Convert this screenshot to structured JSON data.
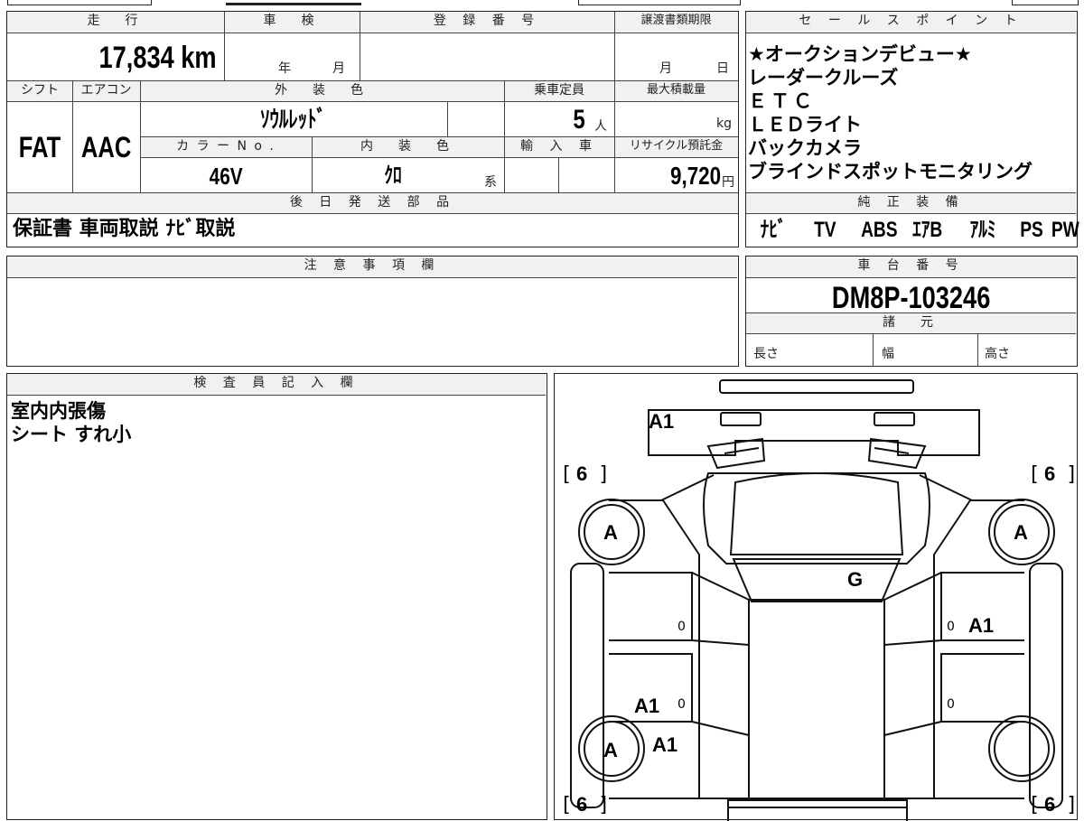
{
  "vehicle": {
    "mileage_label": "走　行",
    "mileage_value": "17,834 km",
    "inspection_label": "車　検",
    "inspection_year_unit": "年",
    "inspection_month_unit": "月",
    "registration_label": "登 録 番 号",
    "transfer_deadline_label": "譲渡書類期限",
    "transfer_month_unit": "月",
    "transfer_day_unit": "日",
    "shift_label": "シフト",
    "ac_label": "エアコン",
    "exterior_color_label": "外　装　色",
    "capacity_label": "乗車定員",
    "max_load_label": "最大積載量",
    "shift_value": "FAT",
    "ac_value": "AAC",
    "exterior_color_value": "ｿｳﾙﾚｯﾄﾞ",
    "capacity_value": "5",
    "capacity_unit": "人",
    "max_load_unit": "kg",
    "color_no_label": "カ ラ ー N o .",
    "interior_color_label": "内　装　色",
    "import_label": "輸 入 車",
    "recycle_label": "リサイクル預託金",
    "color_no_value": "46V",
    "interior_color_value": "ｸﾛ",
    "interior_color_suffix": "系",
    "recycle_value": "9,720",
    "recycle_unit": "円",
    "later_parts_label": "後 日 発 送 部 品",
    "later_parts_value": "保証書 車両取説 ﾅﾋﾞ取説"
  },
  "sales_points": {
    "label": "セ ー ル ス ポ イ ン ト",
    "items": [
      "★オークションデビュー★",
      "レーダークルーズ",
      "ＥＴＣ",
      "ＬＥＤライト",
      "バックカメラ",
      "ブラインドスポットモニタリング"
    ]
  },
  "genuine_equipment": {
    "label": "純 正 装 備",
    "items": [
      "ﾅﾋﾞ",
      "TV",
      "ABS",
      "ｴｱB",
      "ｱﾙﾐ",
      "PS",
      "PW"
    ]
  },
  "notes": {
    "label": "注 意 事 項 欄"
  },
  "chassis": {
    "label": "車 台 番 号",
    "value": "DM8P-103246",
    "specs_label": "諸　元",
    "length_label": "長さ",
    "width_label": "幅",
    "height_label": "高さ"
  },
  "inspector": {
    "label": "検 査 員 記 入 欄",
    "lines": [
      "室内内張傷",
      "シート すれ小"
    ]
  },
  "diagram": {
    "marks": {
      "rear_left": "A1",
      "tread_fl": "6",
      "tread_fr": "6",
      "tread_rl": "6",
      "tread_rr": "6",
      "wheel_fl": "A",
      "wheel_fr": "A",
      "wheel_rl": "A",
      "windshield": "G",
      "right_front_door": "A1",
      "left_rear_door": "A1",
      "left_rocker": "A1",
      "left_front_door_num": "0",
      "right_front_door_num": "0",
      "left_rear_door_num": "0",
      "right_rear_door_num": "0"
    }
  }
}
